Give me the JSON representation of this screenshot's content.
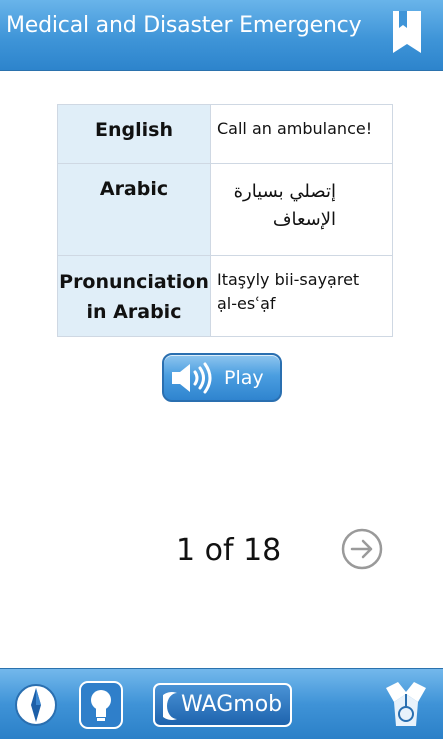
{
  "header": {
    "title": "Medical and Disaster Emergency",
    "bookmark_icon": "bookmark-icon"
  },
  "phrase_table": {
    "rows": [
      {
        "label": "English",
        "value": "Call an ambulance!"
      },
      {
        "label": "Arabic",
        "value": "إتصلي بسيارة الإسعاف"
      },
      {
        "label_line1": "Pronunciation",
        "label_line2": "in Arabic",
        "value_line1": "Itaşyly bii-sayạret",
        "value_line2": "ạl-esʿạf"
      }
    ]
  },
  "play_button": {
    "label": "Play",
    "icon": "speaker-icon"
  },
  "pagination": {
    "counter": "1 of 18",
    "next_icon": "arrow-right-circle-icon"
  },
  "footer": {
    "compass_icon": "compass-icon",
    "bulb_icon": "lightbulb-icon",
    "brand_label": "WAGmob",
    "doctor_icon": "doctor-icon"
  },
  "colors": {
    "header_blue": "#3f95d8",
    "label_cell_bg": "#e0eef8",
    "text": "#111111"
  }
}
